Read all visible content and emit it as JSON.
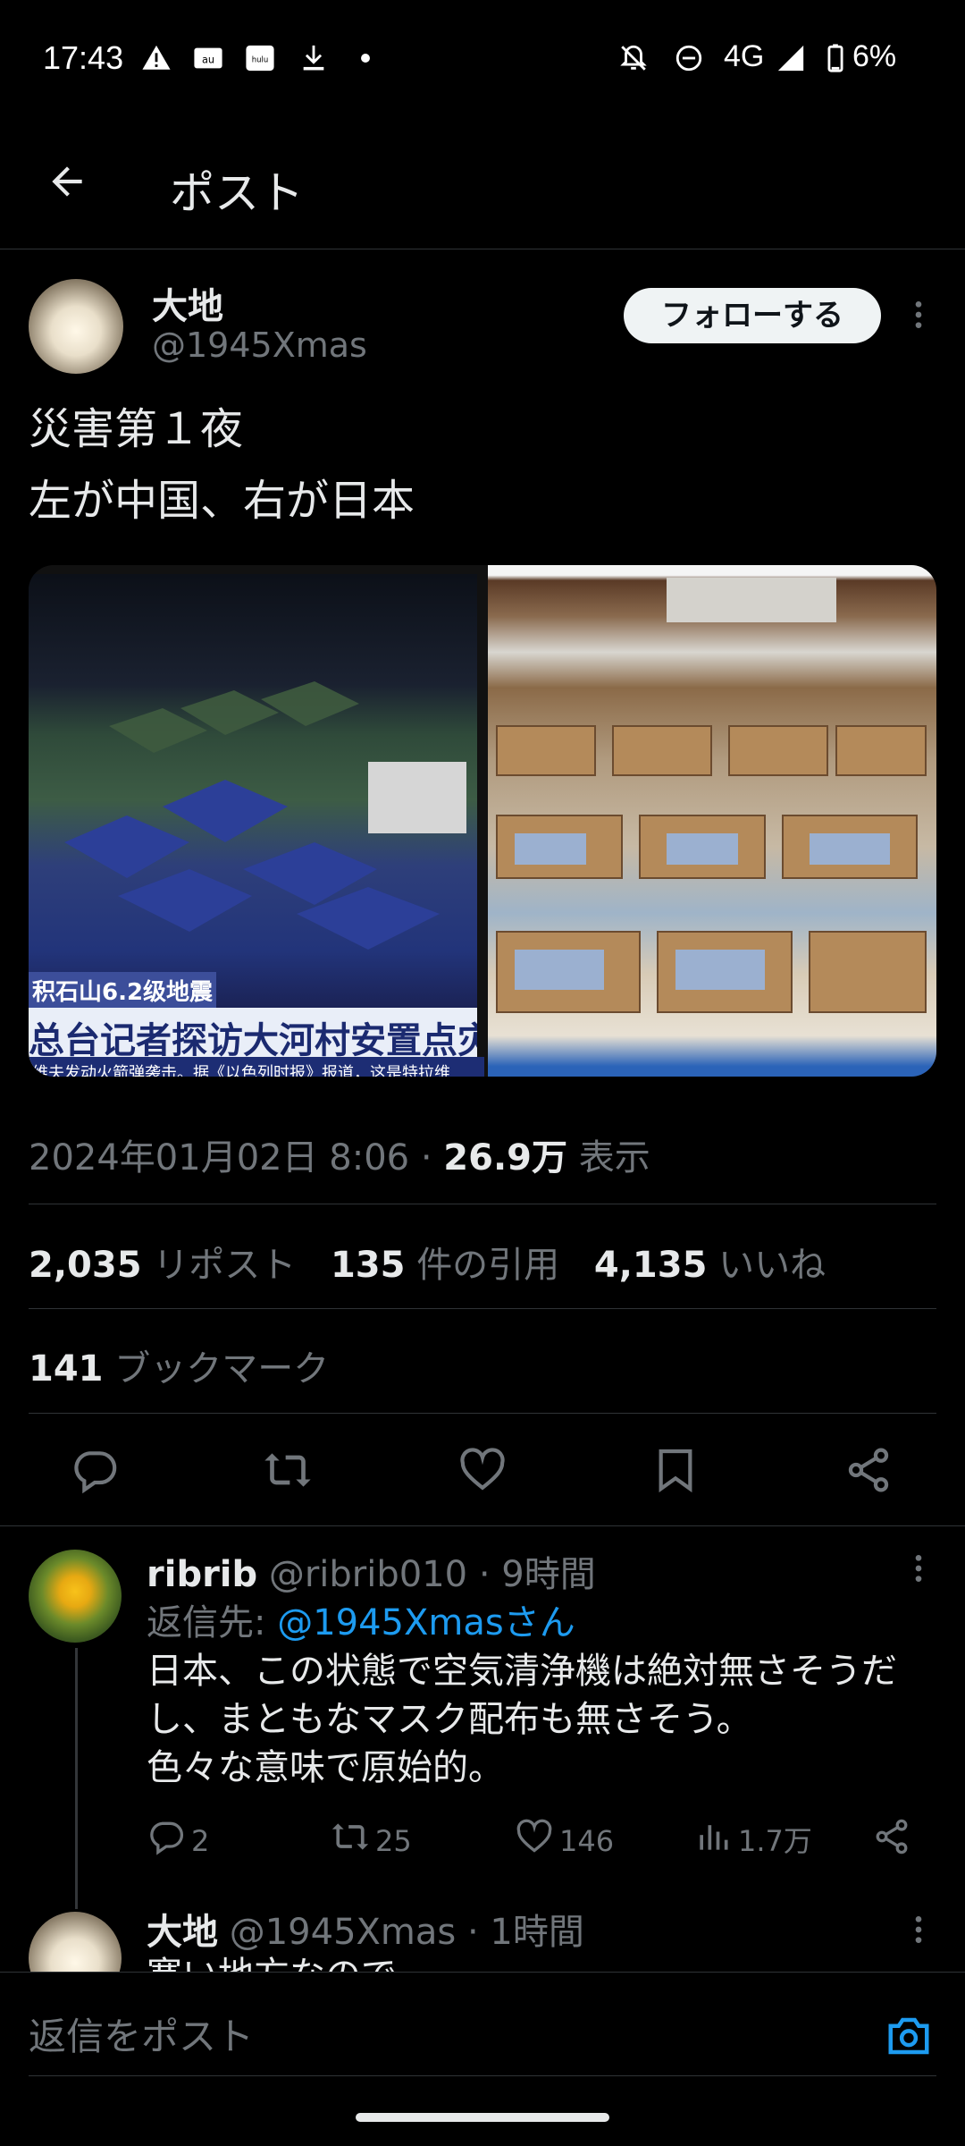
{
  "status_bar": {
    "time": "17:43",
    "left_icons": [
      "warning-icon",
      "au-mail-icon",
      "hulu-icon",
      "download-icon",
      "dot-icon"
    ],
    "right_text": "4G",
    "battery": "6%"
  },
  "header": {
    "title": "ポスト"
  },
  "post": {
    "author_name": "大地",
    "author_handle": "@1945Xmas",
    "follow_label": "フォローする",
    "text_line1": "災害第１夜",
    "text_line2": "左が中国、右が日本",
    "image_left_caption1": "积石山6.2级地震",
    "image_left_caption2": "总台记者探访大河村安置点灾",
    "image_left_caption3": "维夫发动火箭弹袭击。据《以色列时报》报道，这是特拉维",
    "timestamp": "2024年01月02日 8:06",
    "views_count": "26.9万",
    "views_label": "表示",
    "reposts_count": "2,035",
    "reposts_label": "リポスト",
    "quotes_count": "135",
    "quotes_label": "件の引用",
    "likes_count": "4,135",
    "likes_label": "いいね",
    "bookmarks_count": "141",
    "bookmarks_label": "ブックマーク"
  },
  "reply": {
    "name": "ribrib",
    "handle": "@ribrib010",
    "time": "· 9時間",
    "reply_to_prefix": "返信先:",
    "reply_to_handle": "@1945Xmasさん",
    "text_line1": "日本、この状態で空気清浄機は絶対無さそうだ",
    "text_line2": "し、まともなマスク配布も無さそう。",
    "text_line3": "色々な意味で原始的。",
    "replies": "2",
    "reposts": "25",
    "likes": "146",
    "views": "1.7万"
  },
  "reply2": {
    "name": "大地",
    "handle": "@1945Xmas",
    "time": "· 1時間",
    "text_partial": "寒い地方なので"
  },
  "compose": {
    "placeholder": "返信をポスト"
  },
  "colors": {
    "accent": "#1d9bf0",
    "muted": "#71767b",
    "text": "#e7e9ea",
    "bg": "#000000"
  }
}
